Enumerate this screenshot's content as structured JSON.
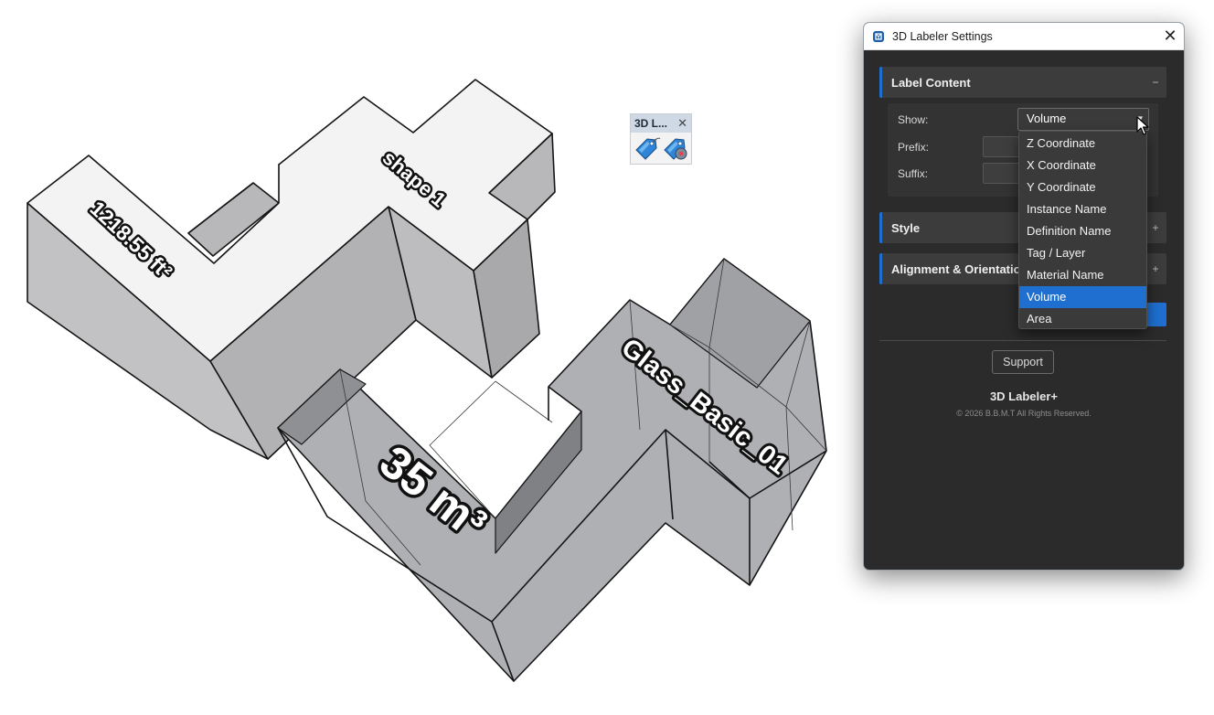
{
  "viewport": {
    "labels": {
      "area": "1218.55 ft²",
      "instance": "shape 1",
      "volume": "35 m³",
      "material": "Glass_Basic_01"
    }
  },
  "toolbar": {
    "title": "3D L...",
    "close": "✕",
    "buttons": [
      {
        "name": "add-label",
        "icon": "blue-tag-icon"
      },
      {
        "name": "label-settings",
        "icon": "tag-gear-icon"
      }
    ]
  },
  "window": {
    "title": "3D Labeler Settings",
    "close": "✕",
    "icon": "sketchup-icon"
  },
  "sections": {
    "label_content": {
      "title": "Label Content",
      "toggle": "−"
    },
    "style": {
      "title": "Style",
      "toggle": "+"
    },
    "alignment": {
      "title": "Alignment & Orientation",
      "toggle": "+"
    }
  },
  "label_content": {
    "show_label": "Show:",
    "show_value": "Volume",
    "prefix_label": "Prefix:",
    "suffix_label": "Suffix:",
    "options": [
      "Z Coordinate",
      "X Coordinate",
      "Y Coordinate",
      "Instance Name",
      "Definition Name",
      "Tag / Layer",
      "Material Name",
      "Volume",
      "Area"
    ],
    "selected": "Volume"
  },
  "footer": {
    "support": "Support",
    "brand": "3D Labeler+",
    "copyright": "© 2026 B.B.M.T All Rights Reserved."
  },
  "colors": {
    "accent": "#1e6fd0",
    "panel_bg": "#2b2b2b",
    "section_bg": "#3c3c3c",
    "solid_top": "#f2f2f2",
    "solid_side": "#b4b4b6",
    "glass": "#aeb0b4"
  }
}
